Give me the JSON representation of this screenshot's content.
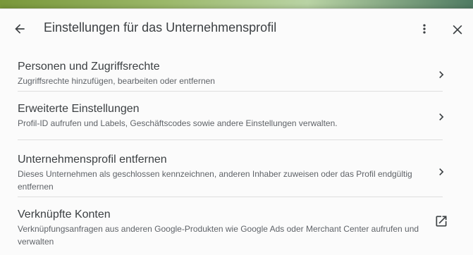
{
  "header": {
    "title": "Einstellungen für das Unternehmensprofil",
    "back_icon": "arrow-back-icon",
    "more_icon": "more-vert-icon",
    "close_icon": "close-icon"
  },
  "items": [
    {
      "title": "Personen und Zugriffsrechte",
      "description": "Zugriffsrechte hinzufügen, bearbeiten oder entfernen",
      "icon": "chevron-right-icon"
    },
    {
      "title": "Erweiterte Einstellungen",
      "description": "Profil-ID aufrufen und Labels, Geschäftscodes sowie andere Einstellungen verwalten.",
      "icon": "chevron-right-icon"
    },
    {
      "title": "Unternehmensprofil entfernen",
      "description": "Dieses Unternehmen als geschlossen kennzeichnen, anderen Inhaber zuweisen oder das Profil endgültig entfernen",
      "icon": "chevron-right-icon"
    },
    {
      "title": "Verknüpfte Konten",
      "description": "Verknüpfungsanfragen aus anderen Google-Produkten wie Google Ads oder Merchant Center aufrufen und verwalten",
      "icon": "open-in-new-icon"
    }
  ],
  "colors": {
    "panel_background": "#fbfbfb",
    "text_primary": "#3c4043",
    "text_secondary": "#5f6368",
    "divider": "#dedede"
  }
}
